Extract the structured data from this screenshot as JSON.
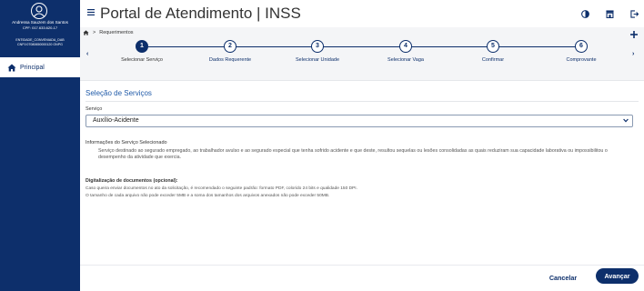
{
  "sidebar": {
    "user_name": "Andressa Sauzem dos Santos",
    "user_cpf": "CPF: 017.633.620-17",
    "user_entity": "ENTIDADE_CONVENIADA_DAB",
    "user_cnpj": "CNPJ:07080650000120 ONPG",
    "nav_items": [
      {
        "label": "Principal",
        "icon": "home-icon"
      }
    ]
  },
  "header": {
    "title": "Portal de Atendimento | INSS",
    "icons": [
      "contrast-icon",
      "store-icon",
      "logout-icon",
      "plus-icon",
      "menu-icon"
    ]
  },
  "breadcrumb": {
    "separator": ">",
    "current": "Requerimentos"
  },
  "stepper": {
    "steps": [
      {
        "number": "1",
        "label": "Selecionar Serviço",
        "active": true
      },
      {
        "number": "2",
        "label": "Dados Requerente",
        "active": false
      },
      {
        "number": "3",
        "label": "Selecionar Unidade",
        "active": false
      },
      {
        "number": "4",
        "label": "Selecionar Vaga",
        "active": false
      },
      {
        "number": "5",
        "label": "Confirmar",
        "active": false
      },
      {
        "number": "6",
        "label": "Comprovante",
        "active": false
      }
    ],
    "prev_arrow": "‹",
    "next_arrow": "›"
  },
  "main": {
    "section_title": "Seleção de Serviços",
    "service_label": "Serviço",
    "service_value": "Auxílio-Acidente",
    "info_title": "Informações do Serviço Selecionado",
    "info_text": "Serviço destinado ao segurado empregado, ao trabalhador avulso e ao segurado especial que tenha sofrido acidente e que deste, resultou sequelas ou lesões consolidadas as quais reduziram sua capacidade laborativa ou impossibilitou o desempenho da atividade que exercia.",
    "digitalization_title": "Digitalização de documentos (opcional):",
    "digitalization_lines": [
      "Caso queira enviar documentos no ato da solicitação, é recomendado o seguinte padrão: formato PDF, colorido 24 bits e qualidade 150 DPI.",
      "O tamanho de cada arquivo não pode exceder 5MB e a soma dos tamanhos dos arquivos anexados não pode exceder 50MB."
    ]
  },
  "footer": {
    "cancel_label": "Cancelar",
    "next_label": "Avançar"
  },
  "colors": {
    "primary": "#0d2f6b",
    "accent": "#1f5aa8",
    "background": "#f4f5f7"
  }
}
